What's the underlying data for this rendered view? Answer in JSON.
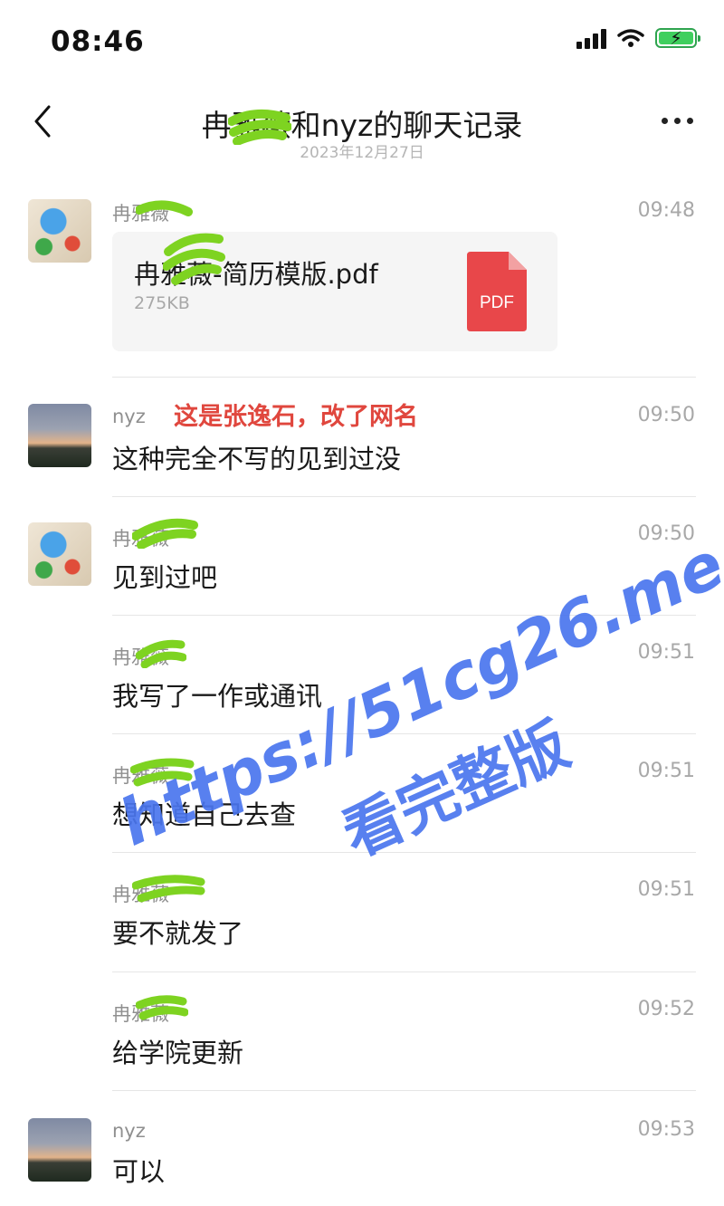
{
  "status_bar": {
    "time": "08:46"
  },
  "header": {
    "title": "冉雅薇和nyz的聊天记录",
    "date": "2023年12月27日"
  },
  "messages": [
    {
      "sender": "冉雅薇",
      "time": "09:48",
      "type": "file",
      "file": {
        "name": "冉雅薇-简历模版.pdf",
        "size": "275KB",
        "icon_label": "PDF"
      }
    },
    {
      "sender": "nyz",
      "time": "09:50",
      "text": "这种完全不写的见到过没",
      "annotation": "这是张逸石，改了网名"
    },
    {
      "sender": "冉雅薇",
      "time": "09:50",
      "text": "见到过吧"
    },
    {
      "sender": "冉雅薇",
      "time": "09:51",
      "text": "我写了一作或通讯"
    },
    {
      "sender": "冉雅薇",
      "time": "09:51",
      "text": "想知道自己去查"
    },
    {
      "sender": "冉雅薇",
      "time": "09:51",
      "text": "要不就发了"
    },
    {
      "sender": "冉雅薇",
      "time": "09:52",
      "text": "给学院更新"
    },
    {
      "sender": "nyz",
      "time": "09:53",
      "text": "可以"
    }
  ],
  "watermark": {
    "line1": "https://51cg26.me",
    "line2": "看完整版"
  },
  "colors": {
    "annotation": "#e0473e",
    "watermark": "#4a76ee",
    "pdf_icon": "#e8474a",
    "redaction": "#7ed321"
  }
}
